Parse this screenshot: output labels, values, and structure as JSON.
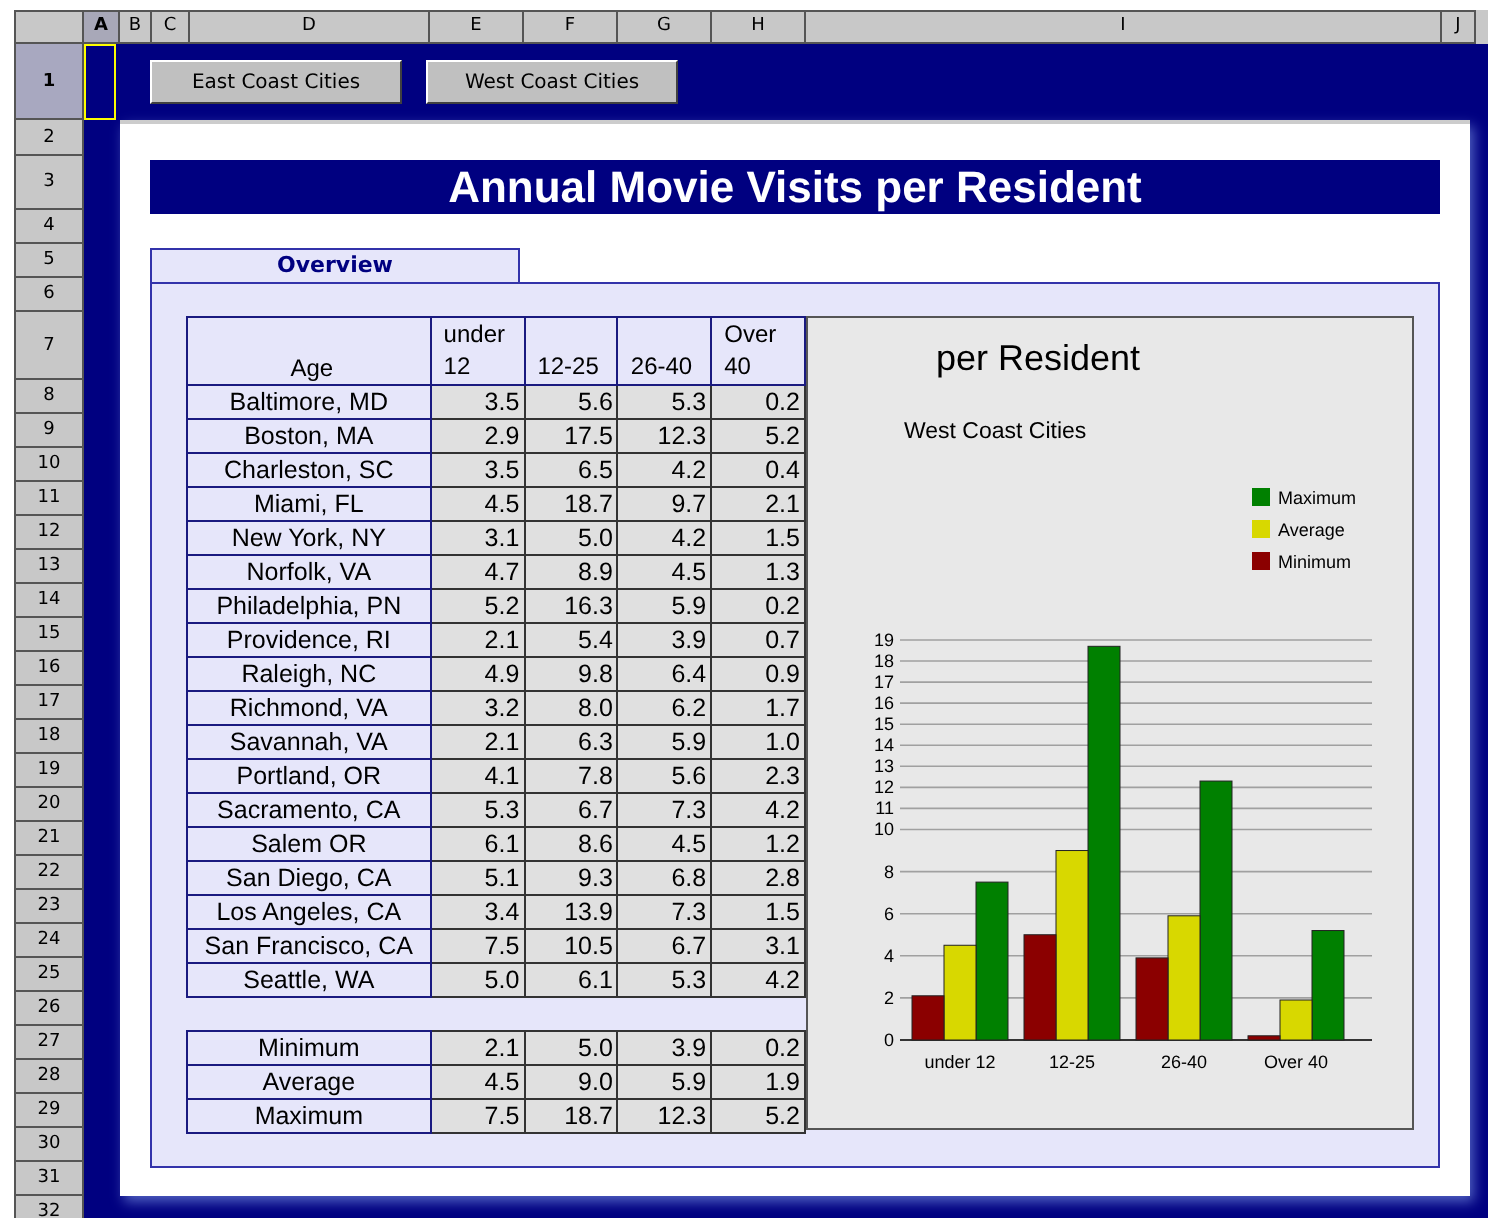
{
  "column_headers": [
    {
      "label": "A",
      "selected": true
    },
    {
      "label": "B",
      "selected": false
    },
    {
      "label": "C",
      "selected": false
    },
    {
      "label": "D",
      "selected": false
    },
    {
      "label": "E",
      "selected": false
    },
    {
      "label": "F",
      "selected": false
    },
    {
      "label": "G",
      "selected": false
    },
    {
      "label": "H",
      "selected": false
    },
    {
      "label": "I",
      "selected": false
    },
    {
      "label": "J",
      "selected": false
    }
  ],
  "row_headers": [
    {
      "label": "1",
      "selected": true
    },
    {
      "label": "2",
      "selected": false
    },
    {
      "label": "3",
      "selected": false
    },
    {
      "label": "4",
      "selected": false
    },
    {
      "label": "5",
      "selected": false
    },
    {
      "label": "6",
      "selected": false
    },
    {
      "label": "7",
      "selected": false
    },
    {
      "label": "8",
      "selected": false
    },
    {
      "label": "9",
      "selected": false
    },
    {
      "label": "10",
      "selected": false
    },
    {
      "label": "11",
      "selected": false
    },
    {
      "label": "12",
      "selected": false
    },
    {
      "label": "13",
      "selected": false
    },
    {
      "label": "14",
      "selected": false
    },
    {
      "label": "15",
      "selected": false
    },
    {
      "label": "16",
      "selected": false
    },
    {
      "label": "17",
      "selected": false
    },
    {
      "label": "18",
      "selected": false
    },
    {
      "label": "19",
      "selected": false
    },
    {
      "label": "20",
      "selected": false
    },
    {
      "label": "21",
      "selected": false
    },
    {
      "label": "22",
      "selected": false
    },
    {
      "label": "23",
      "selected": false
    },
    {
      "label": "24",
      "selected": false
    },
    {
      "label": "25",
      "selected": false
    },
    {
      "label": "26",
      "selected": false
    },
    {
      "label": "27",
      "selected": false
    },
    {
      "label": "28",
      "selected": false
    },
    {
      "label": "29",
      "selected": false
    },
    {
      "label": "30",
      "selected": false
    },
    {
      "label": "31",
      "selected": false
    },
    {
      "label": "32",
      "selected": false
    }
  ],
  "buttons": [
    "East Coast Cities",
    "West Coast Cities"
  ],
  "title": "Annual Movie Visits per Resident",
  "tabs": [
    {
      "label": "Overview",
      "selected": true
    }
  ],
  "table": {
    "columns": [
      "Age",
      "under 12",
      "12-25",
      "26-40",
      "Over 40"
    ],
    "rows": [
      [
        "Baltimore, MD",
        "3.5",
        "5.6",
        "5.3",
        "0.2"
      ],
      [
        "Boston, MA",
        "2.9",
        "17.5",
        "12.3",
        "5.2"
      ],
      [
        "Charleston, SC",
        "3.5",
        "6.5",
        "4.2",
        "0.4"
      ],
      [
        "Miami, FL",
        "4.5",
        "18.7",
        "9.7",
        "2.1"
      ],
      [
        "New York, NY",
        "3.1",
        "5.0",
        "4.2",
        "1.5"
      ],
      [
        "Norfolk, VA",
        "4.7",
        "8.9",
        "4.5",
        "1.3"
      ],
      [
        "Philadelphia, PN",
        "5.2",
        "16.3",
        "5.9",
        "0.2"
      ],
      [
        "Providence, RI",
        "2.1",
        "5.4",
        "3.9",
        "0.7"
      ],
      [
        "Raleigh, NC",
        "4.9",
        "9.8",
        "6.4",
        "0.9"
      ],
      [
        "Richmond, VA",
        "3.2",
        "8.0",
        "6.2",
        "1.7"
      ],
      [
        "Savannah, VA",
        "2.1",
        "6.3",
        "5.9",
        "1.0"
      ],
      [
        "Portland, OR",
        "4.1",
        "7.8",
        "5.6",
        "2.3"
      ],
      [
        "Sacramento, CA",
        "5.3",
        "6.7",
        "7.3",
        "4.2"
      ],
      [
        "Salem OR",
        "6.1",
        "8.6",
        "4.5",
        "1.2"
      ],
      [
        "San Diego, CA",
        "5.1",
        "9.3",
        "6.8",
        "2.8"
      ],
      [
        "Los Angeles, CA",
        "3.4",
        "13.9",
        "7.3",
        "1.5"
      ],
      [
        "San Francisco, CA",
        "7.5",
        "10.5",
        "6.7",
        "3.1"
      ],
      [
        "Seattle, WA",
        "5.0",
        "6.1",
        "5.3",
        "4.2"
      ]
    ],
    "summary_rows": [
      [
        "Minimum",
        "2.1",
        "5.0",
        "3.9",
        "0.2"
      ],
      [
        "Average",
        "4.5",
        "9.0",
        "5.9",
        "1.9"
      ],
      [
        "Maximum",
        "7.5",
        "18.7",
        "12.3",
        "5.2"
      ]
    ]
  },
  "chart": {
    "chart_data": {
      "type": "bar",
      "title": "per Resident",
      "subtitle": "West Coast Cities",
      "categories": [
        "under 12",
        "12-25",
        "26-40",
        "Over 40"
      ],
      "series": [
        {
          "name": "Minimum",
          "color": "#8b0000",
          "values": [
            2.1,
            5.0,
            3.9,
            0.2
          ]
        },
        {
          "name": "Average",
          "color": "#d8d800",
          "values": [
            4.5,
            9.0,
            5.9,
            1.9
          ]
        },
        {
          "name": "Maximum",
          "color": "#008000",
          "values": [
            7.5,
            18.7,
            12.3,
            5.2
          ]
        }
      ],
      "ylim": [
        0,
        19
      ],
      "grid": true,
      "legend": "upper right",
      "yticks": [
        0,
        2,
        4,
        6,
        8,
        10,
        11,
        12,
        13,
        14,
        15,
        16,
        17,
        18,
        19
      ]
    }
  }
}
